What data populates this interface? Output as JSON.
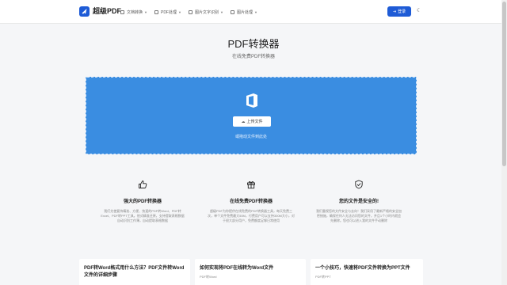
{
  "header": {
    "brand": "超级PDF",
    "nav": [
      {
        "label": "文档转换",
        "has_caret": true
      },
      {
        "label": "PDF处理",
        "has_caret": true
      },
      {
        "label": "图片文字识别",
        "has_caret": true
      },
      {
        "label": "图片处理",
        "has_caret": true
      }
    ],
    "login_label": "登录"
  },
  "hero": {
    "title": "PDF转换器",
    "subtitle": "在线免费PDF转换器"
  },
  "upload": {
    "button_label": "上传文件",
    "hint": "或拖动文件到此处"
  },
  "features": [
    {
      "icon": "thumbs-up-icon",
      "title": "强大的PDF转换器",
      "desc": "我们先使要持精准、方便、快速的PDF转Word、PDF转Excel、PDF转PPT工具。他式精准还原，支持提取表格数据 自动识别工作薄，自动提取表格数据"
    },
    {
      "icon": "gift-icon",
      "title": "在线免费PDF转换器",
      "desc": "超级PDF为你提供在线免费的PDF转换器工具，每天免费三次，单个文件免费最大50M，付费用户可以支持300M大小，对于很大部分用户，免费额度足够日常使用"
    },
    {
      "icon": "shield-icon",
      "title": "您的文件是安全的!",
      "desc": "我们重视您的文件安全与去向！我们采用了最新严格的安全加密措施，确保任何人无法访问您的文件，并且1个小时内就会先删除。您也可以进入我的文件手动删除"
    }
  ],
  "cards": [
    {
      "title": "PDF转Word格式用什么方法？PDF文件转Word文件的详细步骤",
      "tag": ""
    },
    {
      "title": "如何实现将PDF在线转为Word文件",
      "tag": "PDF转Word"
    },
    {
      "title": "一个小技巧，快速将PDF文件转换为PPT文件",
      "tag": "PDF转PPT"
    }
  ],
  "colors": {
    "accent": "#1e5bd6",
    "upload_bg": "#3a8de1",
    "page_bg": "#f5f6f8"
  }
}
